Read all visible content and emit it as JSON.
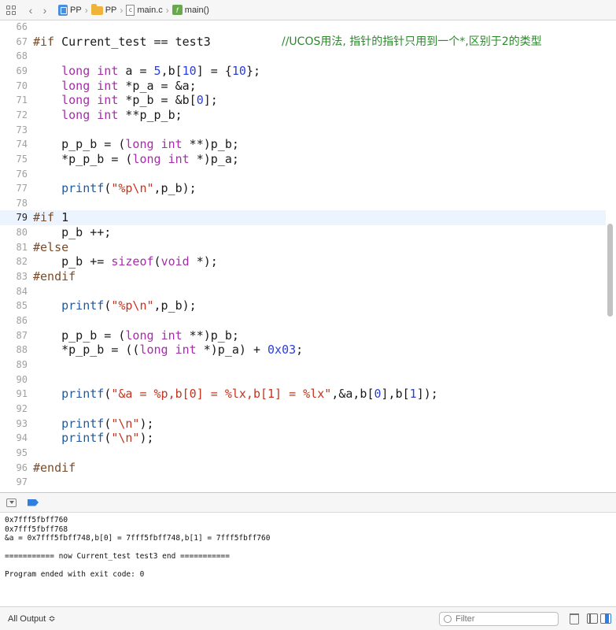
{
  "jumpbar": {
    "crumbs": [
      "PP",
      "PP",
      "main.c",
      "main()"
    ],
    "icons": [
      "grid-icon",
      "back-icon",
      "forward-icon",
      "project-icon",
      "folder-icon",
      "c-file-icon",
      "function-icon"
    ]
  },
  "editor": {
    "current_line": "79",
    "comment": "//UCOS用法, 指针的指针只用到一个*,区别于2的类型",
    "lines": [
      {
        "n": "66",
        "code": ""
      },
      {
        "n": "67",
        "code": "#if Current_test == test3"
      },
      {
        "n": "68",
        "code": ""
      },
      {
        "n": "69",
        "code": "    long int a = 5,b[10] = {10};"
      },
      {
        "n": "70",
        "code": "    long int *p_a = &a;"
      },
      {
        "n": "71",
        "code": "    long int *p_b = &b[0];"
      },
      {
        "n": "72",
        "code": "    long int **p_p_b;"
      },
      {
        "n": "73",
        "code": ""
      },
      {
        "n": "74",
        "code": "    p_p_b = (long int **)p_b;"
      },
      {
        "n": "75",
        "code": "    *p_p_b = (long int *)p_a;"
      },
      {
        "n": "76",
        "code": ""
      },
      {
        "n": "77",
        "code": "    printf(\"%p\\n\",p_b);"
      },
      {
        "n": "78",
        "code": ""
      },
      {
        "n": "79",
        "code": "#if 1"
      },
      {
        "n": "80",
        "code": "    p_b ++;"
      },
      {
        "n": "81",
        "code": "#else"
      },
      {
        "n": "82",
        "code": "    p_b += sizeof(void *);"
      },
      {
        "n": "83",
        "code": "#endif"
      },
      {
        "n": "84",
        "code": ""
      },
      {
        "n": "85",
        "code": "    printf(\"%p\\n\",p_b);"
      },
      {
        "n": "86",
        "code": ""
      },
      {
        "n": "87",
        "code": "    p_p_b = (long int **)p_b;"
      },
      {
        "n": "88",
        "code": "    *p_p_b = ((long int *)p_a) + 0x03;"
      },
      {
        "n": "89",
        "code": ""
      },
      {
        "n": "90",
        "code": ""
      },
      {
        "n": "91",
        "code": "    printf(\"&a = %p,b[0] = %lx,b[1] = %lx\",&a,b[0],b[1]);"
      },
      {
        "n": "92",
        "code": ""
      },
      {
        "n": "93",
        "code": "    printf(\"\\n\");"
      },
      {
        "n": "94",
        "code": "    printf(\"\\n\");"
      },
      {
        "n": "95",
        "code": ""
      },
      {
        "n": "96",
        "code": "#endif"
      },
      {
        "n": "97",
        "code": ""
      }
    ]
  },
  "console": {
    "lines": [
      "0x7fff5fbff760",
      "0x7fff5fbff768",
      "&a = 0x7fff5fbff748,b[0] = 7fff5fbff748,b[1] = 7fff5fbff760",
      "",
      "=========== now Current_test test3 end ===========",
      "",
      "Program ended with exit code: 0"
    ]
  },
  "bottombar": {
    "output_select": "All Output ≎",
    "filter_placeholder": "Filter"
  }
}
